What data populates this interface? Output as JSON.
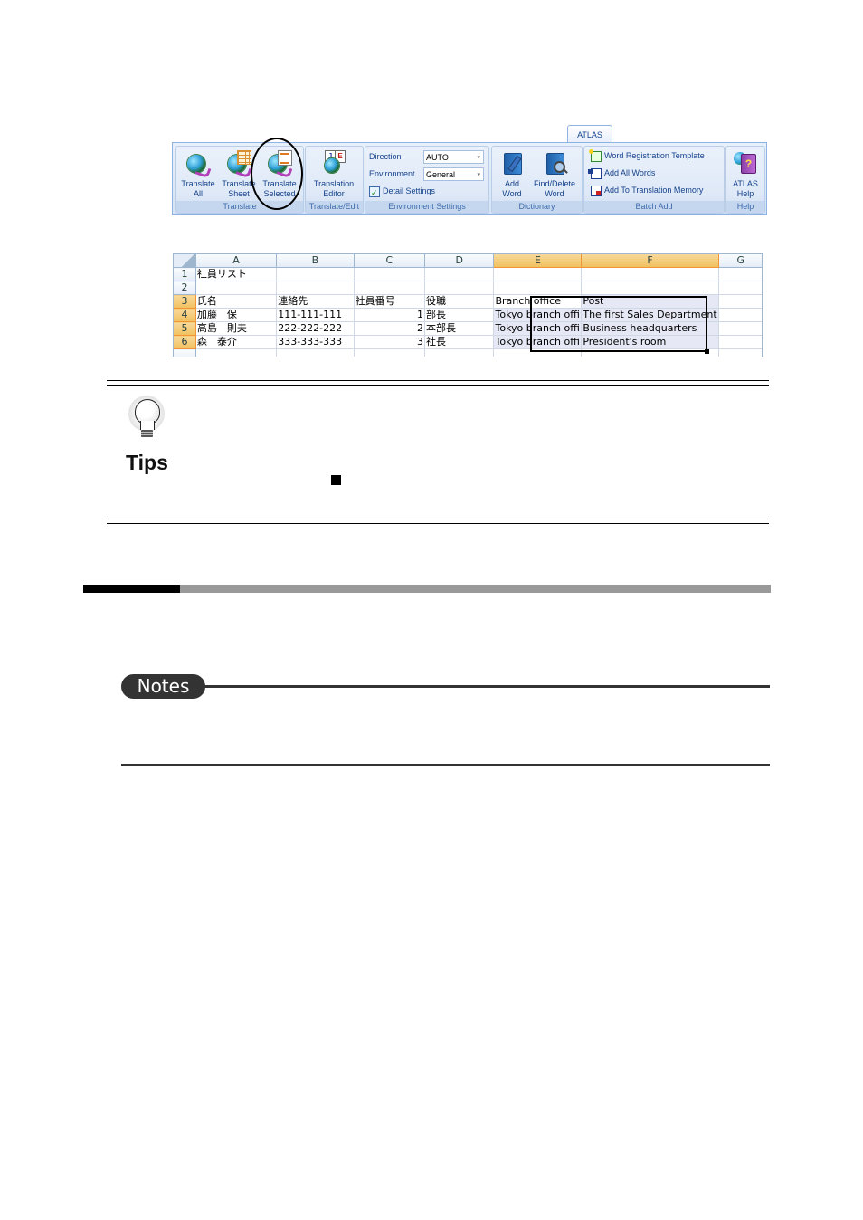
{
  "ribbon": {
    "tab_label": "ATLAS",
    "groups": {
      "translate": {
        "label": "Translate",
        "buttons": [
          {
            "line1": "Translate",
            "line2": "All",
            "icon": "globe-translate-icon"
          },
          {
            "line1": "Translate",
            "line2": "Sheet",
            "icon": "translate-sheet-icon"
          },
          {
            "line1": "Translate",
            "line2": "Selected",
            "icon": "translate-selected-icon"
          }
        ]
      },
      "translate_edit": {
        "label": "Translate/Edit",
        "button": {
          "line1": "Translation",
          "line2": "Editor",
          "icon": "translation-editor-icon"
        }
      },
      "environment": {
        "label": "Environment Settings",
        "direction_label": "Direction",
        "direction_value": "AUTO",
        "environment_label": "Environment",
        "environment_value": "General",
        "detail_settings": "Detail Settings"
      },
      "dictionary": {
        "label": "Dictionary",
        "buttons": [
          {
            "line1": "Add",
            "line2": "Word",
            "icon": "add-word-icon"
          },
          {
            "line1": "Find/Delete",
            "line2": "Word",
            "icon": "find-delete-word-icon"
          }
        ]
      },
      "batch_add": {
        "label": "Batch Add",
        "items": [
          "Word Registration Template",
          "Add All Words",
          "Add To Translation Memory"
        ]
      },
      "help": {
        "label": "Help",
        "button": {
          "line1": "ATLAS",
          "line2": "Help",
          "icon": "atlas-help-icon"
        }
      }
    }
  },
  "spreadsheet": {
    "columns": [
      "A",
      "B",
      "C",
      "D",
      "E",
      "F",
      "G"
    ],
    "selected_columns": [
      "E",
      "F"
    ],
    "rows": [
      {
        "num": "1",
        "cells": [
          "社員リスト",
          "",
          "",
          "",
          "",
          "",
          ""
        ]
      },
      {
        "num": "2",
        "cells": [
          "",
          "",
          "",
          "",
          "",
          "",
          ""
        ]
      },
      {
        "num": "3",
        "cells": [
          "氏名",
          "連絡先",
          "社員番号",
          "役職",
          "Branch office",
          "Post",
          ""
        ]
      },
      {
        "num": "4",
        "cells": [
          "加藤　保",
          "111-111-111",
          "1",
          "部長",
          "Tokyo branch offi",
          "The first Sales Department",
          ""
        ]
      },
      {
        "num": "5",
        "cells": [
          "高島　則夫",
          "222-222-222",
          "2",
          "本部長",
          "Tokyo branch offi",
          "Business headquarters",
          ""
        ]
      },
      {
        "num": "6",
        "cells": [
          "森　泰介",
          "333-333-333",
          "3",
          "社長",
          "Tokyo branch offi",
          "President's room",
          ""
        ]
      }
    ]
  },
  "tips": {
    "label": "Tips"
  },
  "notes": {
    "label": "Notes"
  }
}
